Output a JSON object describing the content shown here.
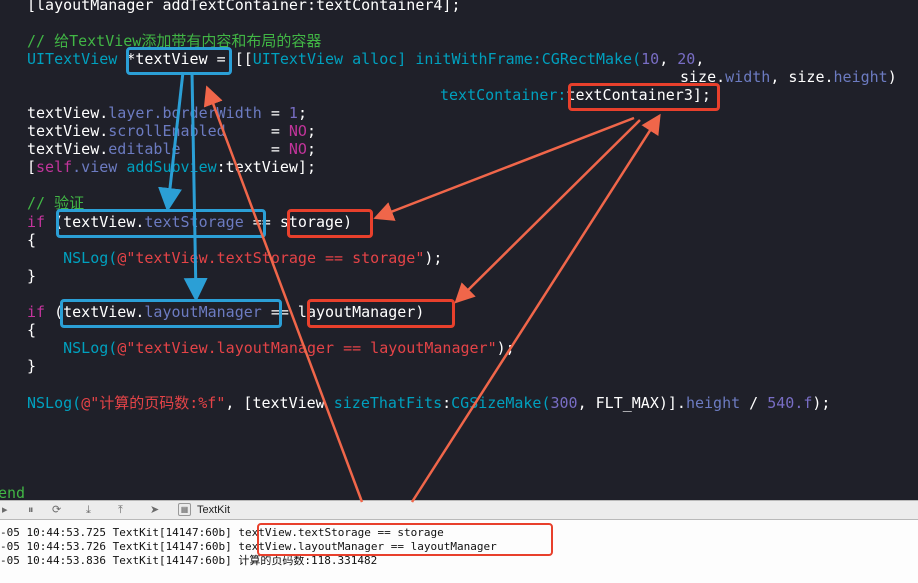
{
  "editor": {
    "line_add_container": "[layoutManager addTextContainer:textContainer4];",
    "comment_create": "// 给TextView添加带有内容和布局的容器",
    "decl_type": "UITextView",
    "decl_var": "*textView",
    "decl_eq": " = [[",
    "decl_cls": "UITextView",
    "decl_alloc": " alloc] ",
    "decl_init": "initWithFrame:",
    "decl_rect": "CGRectMake(",
    "decl_n10": "10",
    "decl_comma": ", ",
    "decl_n20": "20",
    "decl_tail": ",",
    "size_line_a": "size.",
    "size_width": "width",
    "size_line_b": ", size.",
    "size_height": "height",
    "size_line_c": ")",
    "tc_key": "textContainer:",
    "tc_val": "textContainer3",
    "tc_end": "];",
    "l_border_a": "textView.",
    "l_border_b": "layer.borderWidth",
    "l_border_c": " = ",
    "l_border_d": "1",
    "l_border_e": ";",
    "l_scroll_a": "textView.",
    "l_scroll_b": "scrollEnabled",
    "l_scroll_c": "     = ",
    "l_scroll_d": "NO",
    "l_scroll_e": ";",
    "l_edit_a": "textView.",
    "l_edit_b": "editable",
    "l_edit_c": "          = ",
    "l_edit_d": "NO",
    "l_edit_e": ";",
    "l_add_a": "[",
    "l_add_b": "self",
    "l_add_c": ".view ",
    "l_add_d": "addSubview",
    "l_add_e": ":textView];",
    "comment_verify": "// 验证",
    "if1_kw": "if",
    "if1_a": " (textView.",
    "if1_b": "textStorage",
    "if1_c": " == storage)",
    "brace_open": "{",
    "log1_a": "    NSLog(",
    "log1_b": "@\"textView.textStorage == storage\"",
    "log1_c": ");",
    "brace_close": "}",
    "if2_kw": "if",
    "if2_a": " (textView.",
    "if2_b": "layoutManager",
    "if2_c": " == layoutManager)",
    "log2_a": "    NSLog(",
    "log2_b": "@\"textView.layoutManager == layoutManager\"",
    "log2_c": ");",
    "log3_a": "NSLog(",
    "log3_b": "@\"计算的页码数:%f\"",
    "log3_c": ", [textView ",
    "log3_d": "sizeThatFits",
    "log3_e": ":",
    "log3_f": "CGSizeMake(",
    "log3_g": "300",
    "log3_h": ", FLT_MAX)].",
    "log3_i": "height",
    "log3_j": " / ",
    "log3_k": "540.f",
    "log3_l": ");",
    "end_kw": "end"
  },
  "toolbar": {
    "target_label": "TextKit"
  },
  "console": {
    "lines": [
      "-05 10:44:53.725 TextKit[14147:60b] textView.textStorage == storage",
      "-05 10:44:53.726 TextKit[14147:60b] textView.layoutManager == layoutManager",
      "-05 10:44:53.836 TextKit[14147:60b] 计算的页码数:118.331482"
    ]
  },
  "colors": {
    "editor_bg": "#1f2029",
    "comment": "#41b645",
    "keyword": "#c2349b",
    "class": "#00a0be",
    "property": "#6c7bc1",
    "number": "#786dc4",
    "string": "#e44347",
    "highlight_blue": "#2b9fd6",
    "highlight_red": "#e8402c",
    "arrow_orange": "#f0664a"
  }
}
